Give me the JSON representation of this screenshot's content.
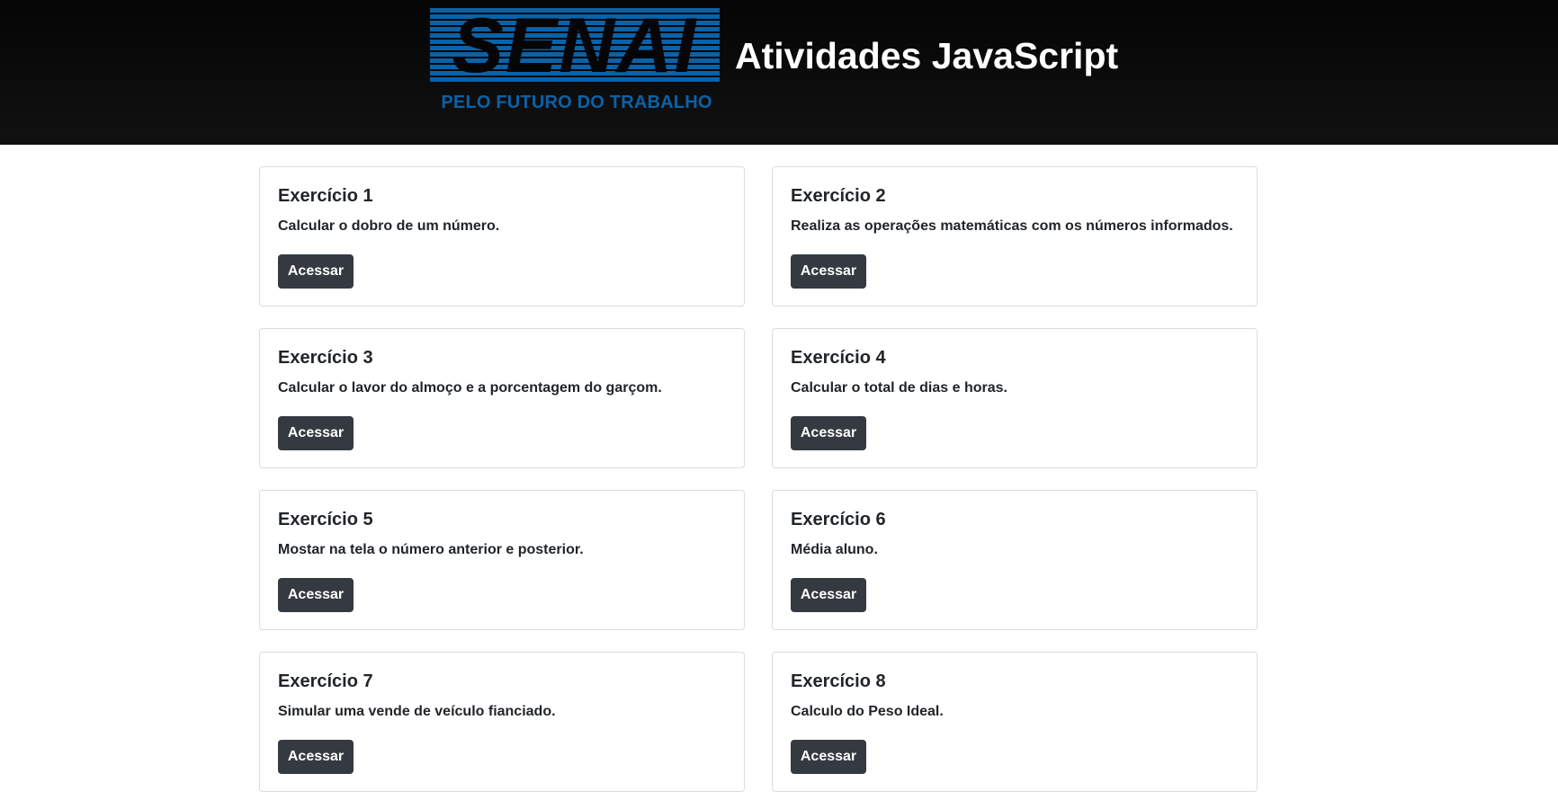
{
  "header": {
    "logo": {
      "word": "SENAI",
      "tagline": "PELO FUTURO DO TRABALHO",
      "brand_color": "#0a62a8"
    },
    "title": "Atividades JavaScript",
    "background": "#0b0b0b"
  },
  "cards": [
    {
      "title": "Exercício 1",
      "text": "Calcular o dobro de um número.",
      "button": "Acessar"
    },
    {
      "title": "Exercício 2",
      "text": "Realiza as operações matemáticas com os números informados.",
      "button": "Acessar"
    },
    {
      "title": "Exercício 3",
      "text": "Calcular o lavor do almoço e a porcentagem do garçom.",
      "button": "Acessar"
    },
    {
      "title": "Exercício 4",
      "text": "Calcular o total de dias e horas.",
      "button": "Acessar"
    },
    {
      "title": "Exercício 5",
      "text": "Mostar na tela o número anterior e posterior.",
      "button": "Acessar"
    },
    {
      "title": "Exercício 6",
      "text": "Média aluno.",
      "button": "Acessar"
    },
    {
      "title": "Exercício 7",
      "text": "Simular uma vende de veículo fianciado.",
      "button": "Acessar"
    },
    {
      "title": "Exercício 8",
      "text": "Calculo do Peso Ideal.",
      "button": "Acessar"
    }
  ],
  "colors": {
    "button": "#343a40",
    "card_border": "#dcdcdc"
  }
}
